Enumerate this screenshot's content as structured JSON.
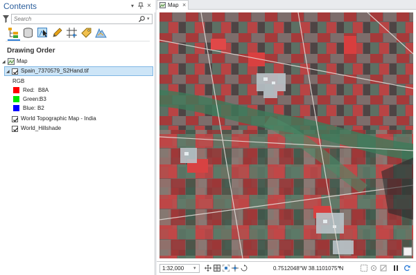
{
  "contents": {
    "title": "Contents",
    "search_placeholder": "Search",
    "heading": "Drawing Order",
    "toolbar_icons": [
      "list-by-drawing-order-icon",
      "list-by-data-source-icon",
      "list-by-selection-icon",
      "list-by-editing-icon",
      "list-by-snapping-icon",
      "list-by-labeling-icon",
      "list-by-perspective-icon"
    ]
  },
  "tree": {
    "map_label": "Map",
    "raster_layer": "Spain_7370579_S2Hand.tif",
    "renderer": "RGB",
    "bands": [
      {
        "label": "Red:",
        "band": "B8A",
        "color": "#ff0000"
      },
      {
        "label": "Green:",
        "band": "B3",
        "color": "#00e400"
      },
      {
        "label": "Blue:",
        "band": "B2",
        "color": "#0000ff"
      }
    ],
    "basemap_layers": [
      "World Topographic Map - India",
      "World_Hillshade"
    ]
  },
  "map_view": {
    "tab_label": "Map",
    "scale": "1:32,000",
    "coordinates": "0.7512048°W 38.1101075°N"
  }
}
